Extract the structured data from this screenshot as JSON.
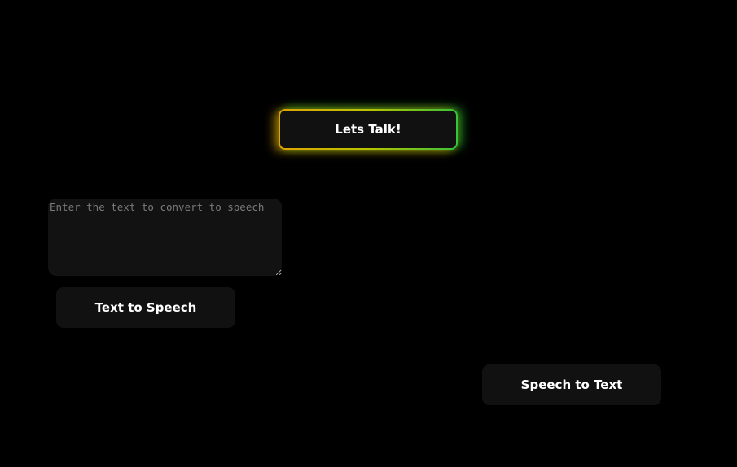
{
  "header": {
    "lets_talk_label": "Lets Talk!"
  },
  "text_to_speech": {
    "input_value": "",
    "input_placeholder": "Enter the text to convert to speech",
    "button_label": "Text to Speech"
  },
  "speech_to_text": {
    "button_label": "Speech to Text"
  },
  "colors": {
    "background": "#000000",
    "button_bg": "#111111",
    "glow_left": "#e0a300",
    "glow_right": "#38c23a"
  }
}
